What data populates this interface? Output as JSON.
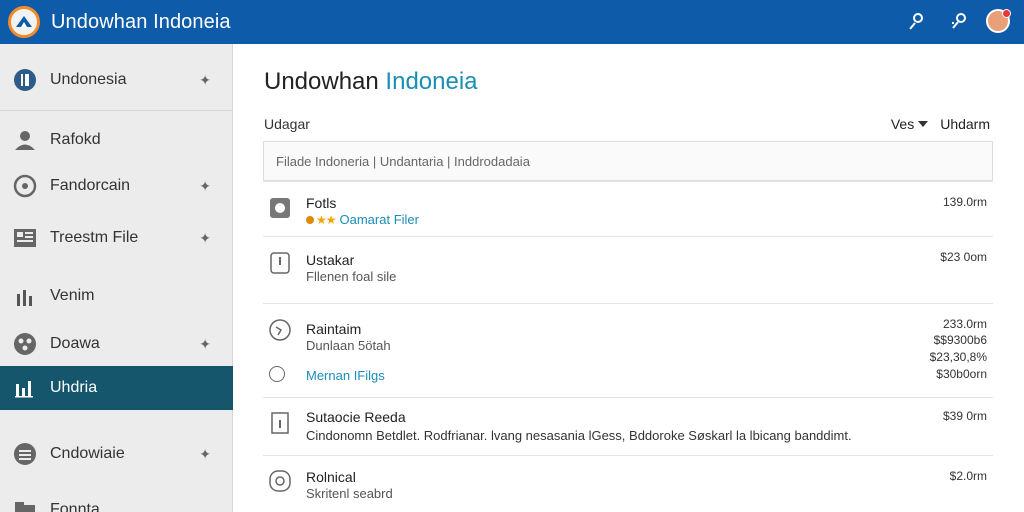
{
  "header": {
    "title": "Undowhan Indoneia",
    "actions": [
      {
        "icon": "user-search-icon"
      },
      {
        "icon": "link-icon"
      },
      {
        "icon": "avatar"
      }
    ]
  },
  "sidebar": {
    "items": [
      {
        "label": "Undonesia",
        "icon": "globe-icon",
        "expandable": true
      },
      {
        "label": "Rafokd",
        "icon": "user-icon",
        "expandable": false
      },
      {
        "label": "Fandorcain",
        "icon": "compass-icon",
        "expandable": true
      },
      {
        "label": "Treestm File",
        "icon": "file-icon",
        "expandable": true
      },
      {
        "label": "Venim",
        "icon": "chart-icon",
        "expandable": false
      },
      {
        "label": "Doawa",
        "icon": "settings-icon",
        "expandable": true
      },
      {
        "label": "Uhdria",
        "icon": "bar-chart-icon",
        "expandable": false,
        "active": true
      },
      {
        "label": "Cndowiaie",
        "icon": "list-icon",
        "expandable": true
      },
      {
        "label": "Fonnta",
        "icon": "folder-icon",
        "expandable": false
      }
    ]
  },
  "main": {
    "title_main": "Undowhan ",
    "title_accent": "Indoneia",
    "sub_label": "Udagar",
    "dropdown_label": "Ves",
    "right_label": "Uhdarm",
    "search_text": "Filade Indoneria | Undantaria | Inddrodadaia",
    "rows": [
      {
        "title": "Fotls",
        "sub": "Oamarat Filer",
        "sub_style": "link",
        "stars": "★★",
        "price": [
          "139.0rm"
        ],
        "icon": "camera-icon"
      },
      {
        "title": "Ustakar",
        "sub": "Fllenen foal sile",
        "price": [
          "$23 0om"
        ],
        "icon": "info-icon"
      },
      {
        "title": "Raintaim",
        "sub": "Dunlaan 5ötah",
        "price": [
          "233.0rm",
          "$$9300b6",
          "$23,30,8%",
          "$30b0orn"
        ],
        "icon": "compass-icon",
        "radio_label": "Mernan IFilgs"
      },
      {
        "title": "Sutaocie Reeda",
        "sub": "Cindonomn Betdlet. Rodfrianar. lvang nesasania lGess, Bddoroke Søskarl la lbicang banddimt.",
        "price": [
          "$39 0rm"
        ],
        "icon": "document-icon"
      },
      {
        "title": "Rolnical",
        "sub": "Skritenl seabrd",
        "price": [
          "$2.0rm"
        ],
        "icon": "refresh-icon"
      }
    ]
  },
  "colors": {
    "header": "#0d5ba9",
    "active_sidebar": "#16566d",
    "accent": "#1a8fb3"
  }
}
